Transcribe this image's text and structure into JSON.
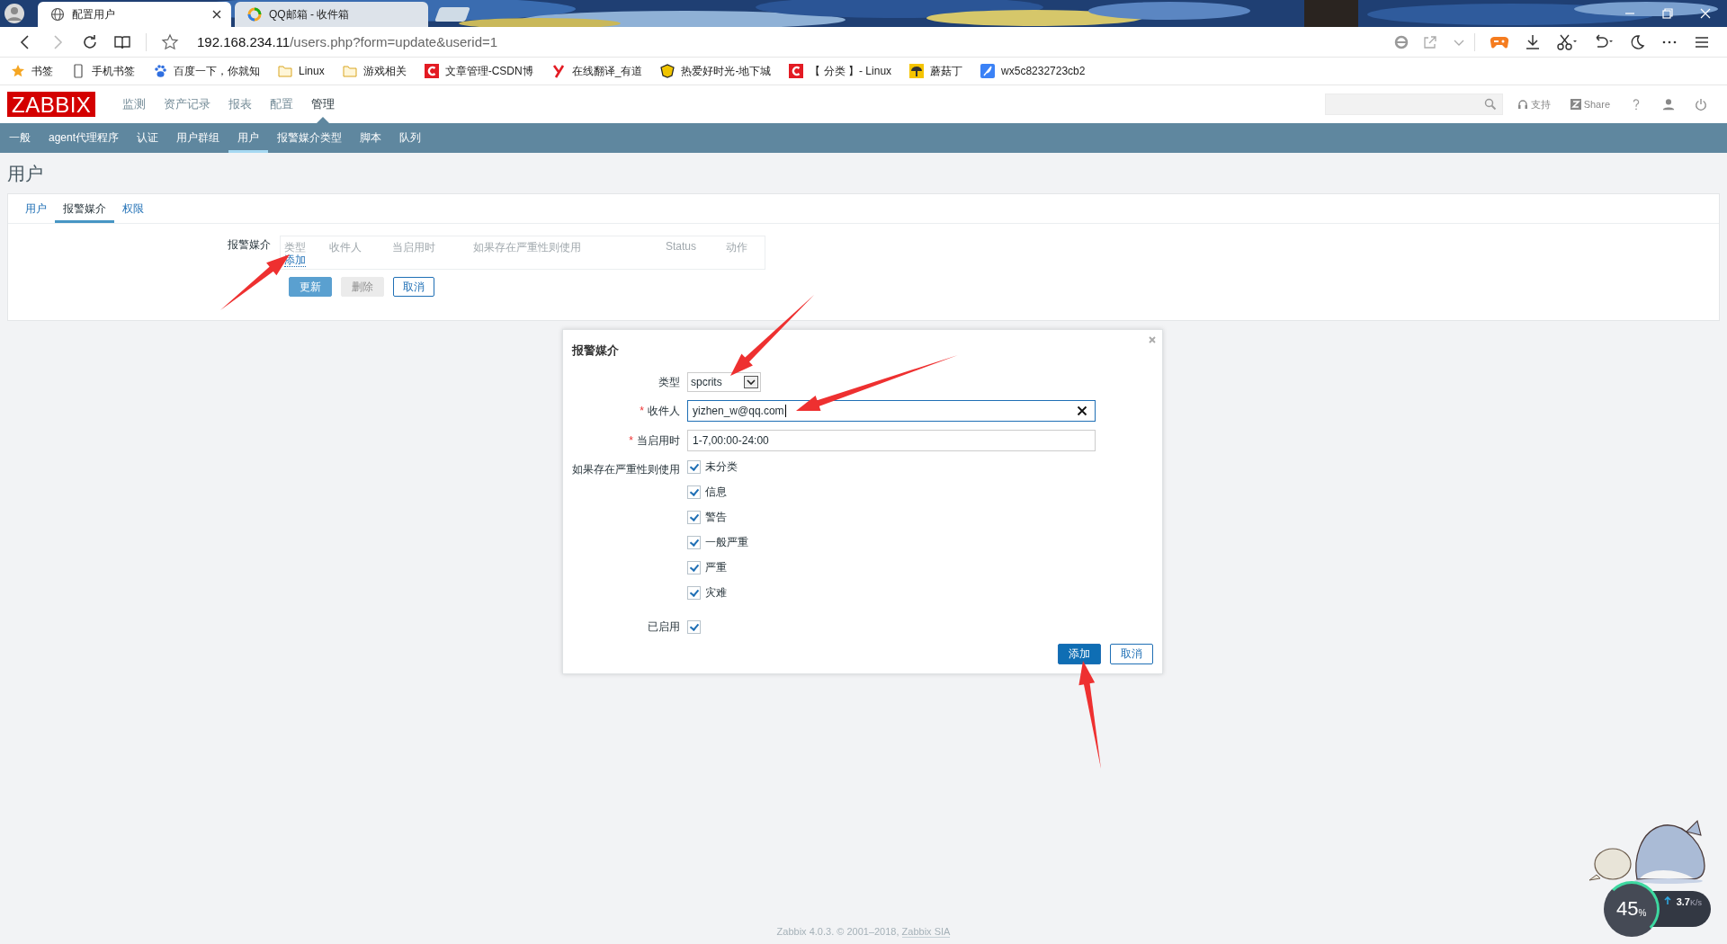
{
  "browser": {
    "tabs": [
      {
        "title": "配置用户",
        "selected": true,
        "kind": "globe"
      },
      {
        "title": "QQ邮箱 - 收件箱",
        "selected": false,
        "kind": "qq"
      }
    ],
    "address": {
      "host": "192.168.234.11",
      "path": "/users.php?form=update&userid=1"
    },
    "bookmarks": [
      {
        "label": "书签",
        "kind": "star"
      },
      {
        "label": "手机书签",
        "kind": "phone"
      },
      {
        "label": "百度一下，你就知",
        "kind": "paw"
      },
      {
        "label": "Linux",
        "kind": "folder"
      },
      {
        "label": "游戏相关",
        "kind": "folder"
      },
      {
        "label": "文章管理-CSDN博",
        "kind": "c-logo"
      },
      {
        "label": "在线翻译_有道",
        "kind": "y-logo"
      },
      {
        "label": "热爱好时光-地下城",
        "kind": "badge"
      },
      {
        "label": "【 分类 】- Linux",
        "kind": "c-logo"
      },
      {
        "label": "蘑菇丁",
        "kind": "mushroom"
      },
      {
        "label": "wx5c8232723cb2",
        "kind": "feather"
      }
    ]
  },
  "zabbix": {
    "logo": "ZABBIX",
    "menu": [
      {
        "label": "监测",
        "selected": false
      },
      {
        "label": "资产记录",
        "selected": false
      },
      {
        "label": "报表",
        "selected": false
      },
      {
        "label": "配置",
        "selected": false
      },
      {
        "label": "管理",
        "selected": true
      }
    ],
    "header_links": [
      {
        "label": "支持",
        "kind": "headset"
      },
      {
        "label": "Share",
        "kind": "z-box"
      }
    ],
    "submenu": [
      {
        "label": "一般",
        "selected": false
      },
      {
        "label": "agent代理程序",
        "selected": false
      },
      {
        "label": "认证",
        "selected": false
      },
      {
        "label": "用户群组",
        "selected": false
      },
      {
        "label": "用户",
        "selected": true
      },
      {
        "label": "报警媒介类型",
        "selected": false
      },
      {
        "label": "脚本",
        "selected": false
      },
      {
        "label": "队列",
        "selected": false
      }
    ]
  },
  "page_title": "用户",
  "form_tabs": [
    {
      "label": "用户",
      "selected": false
    },
    {
      "label": "报警媒介",
      "selected": true
    },
    {
      "label": "权限",
      "selected": false
    }
  ],
  "media": {
    "label": "报警媒介",
    "columns": [
      "类型",
      "收件人",
      "当启用时",
      "如果存在严重性则使用",
      "Status",
      "动作"
    ],
    "add_link": "添加"
  },
  "form_buttons": [
    {
      "label": "更新",
      "kind": "primary",
      "disabled": false
    },
    {
      "label": "删除",
      "kind": "secondary",
      "disabled": true
    },
    {
      "label": "取消",
      "kind": "secondary",
      "disabled": false
    }
  ],
  "dialog": {
    "title": "报警媒介",
    "type": {
      "label": "类型",
      "value": "spcrits"
    },
    "recipient": {
      "label": "收件人",
      "required_mark": "*",
      "value": "yizhen_w@qq.com"
    },
    "when": {
      "label": "当启用时",
      "required_mark": "*",
      "value": "1-7,00:00-24:00"
    },
    "severity": {
      "label": "如果存在严重性则使用",
      "options": [
        {
          "label": "未分类",
          "checked": true
        },
        {
          "label": "信息",
          "checked": true
        },
        {
          "label": "警告",
          "checked": true
        },
        {
          "label": "一般严重",
          "checked": true
        },
        {
          "label": "严重",
          "checked": true
        },
        {
          "label": "灾难",
          "checked": true
        }
      ]
    },
    "enabled": {
      "label": "已启用",
      "checked": true
    },
    "buttons": [
      {
        "label": "添加",
        "kind": "primary"
      },
      {
        "label": "取消",
        "kind": "secondary"
      }
    ]
  },
  "footer": {
    "text": "Zabbix 4.0.3. © 2001–2018, ",
    "link": "Zabbix SIA"
  },
  "net_widget": {
    "percent": "45",
    "unit": "%",
    "speed": "3.7",
    "speed_unit": "K/s"
  }
}
